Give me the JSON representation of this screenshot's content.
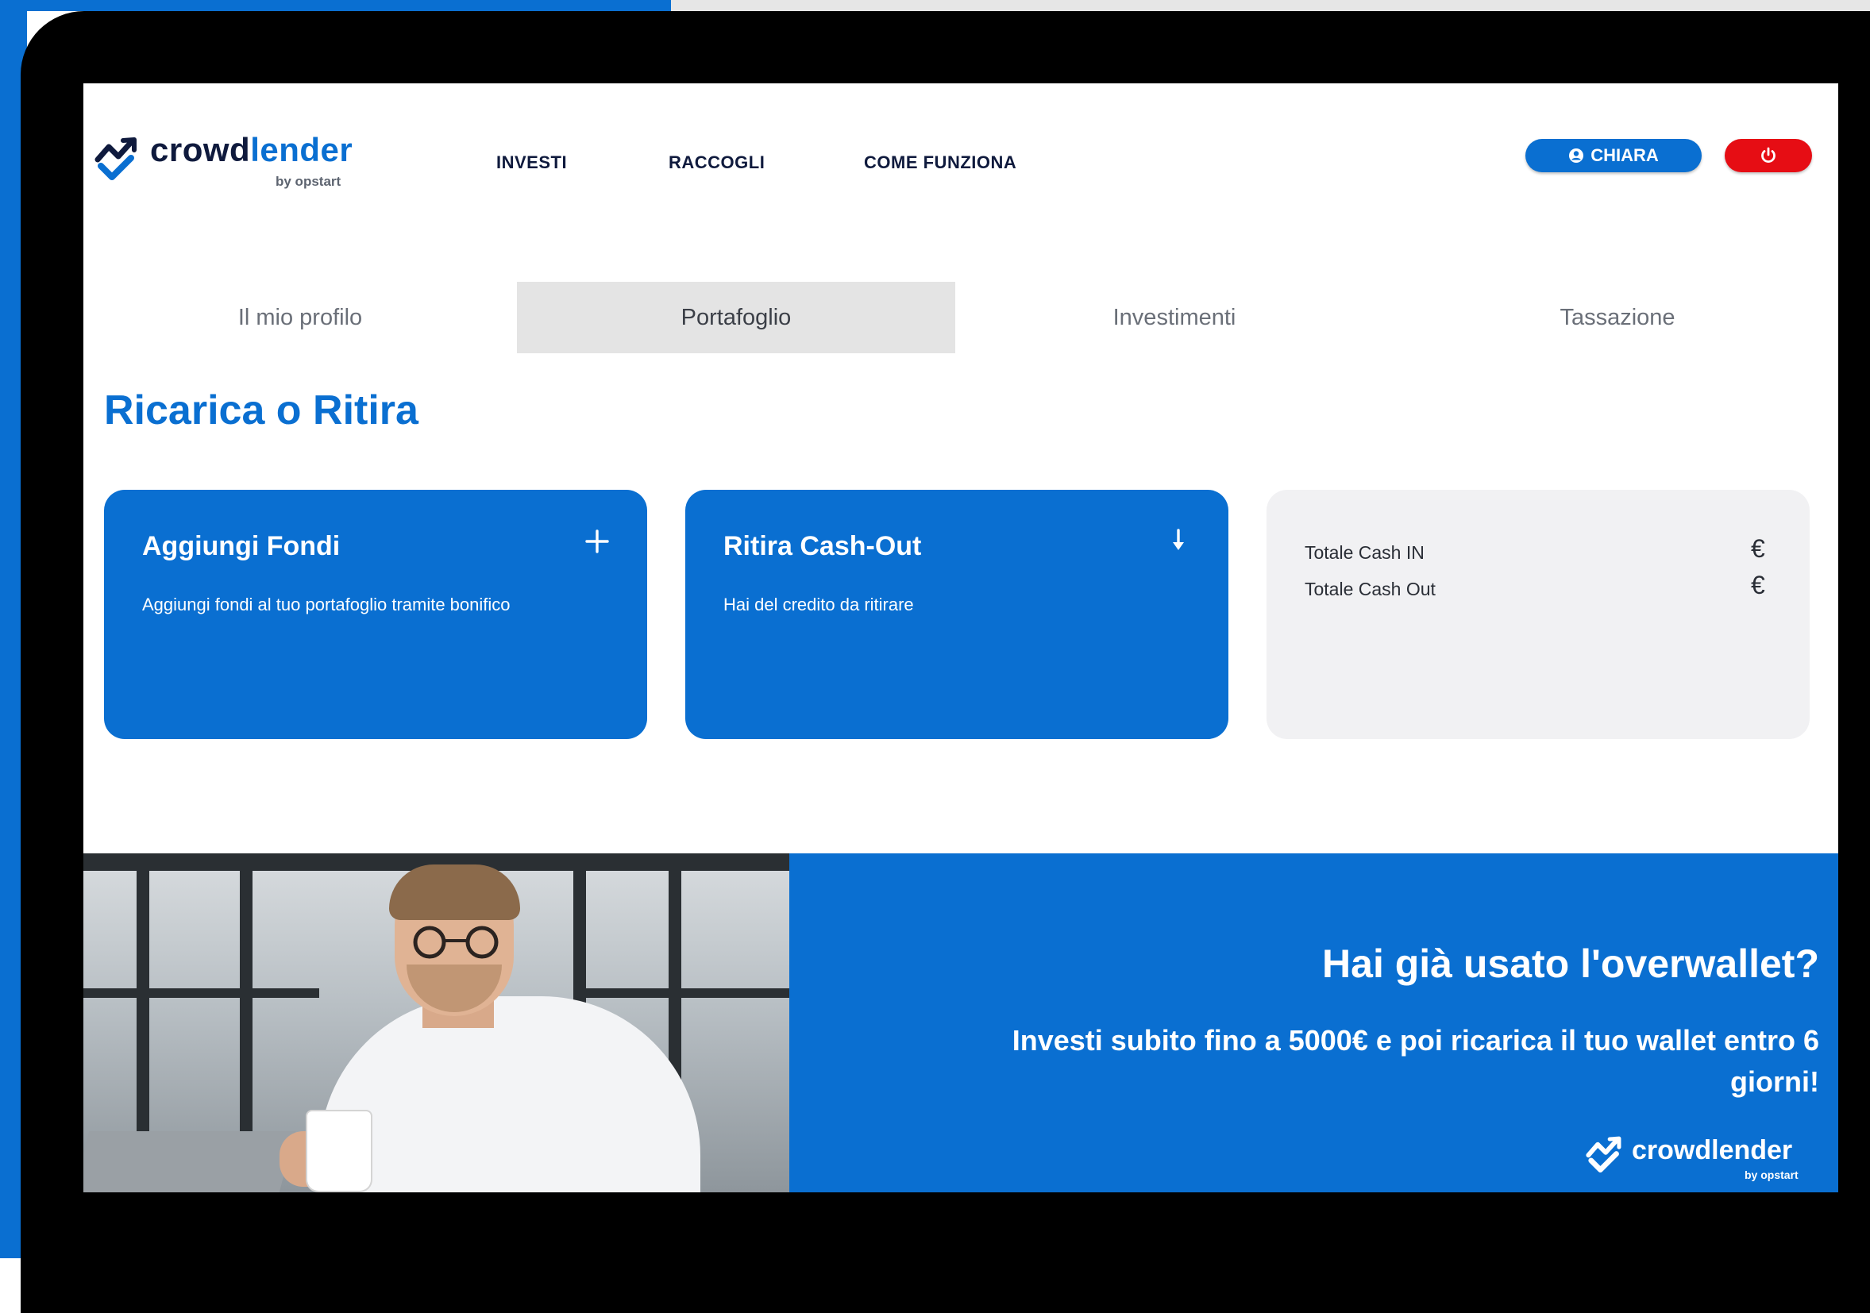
{
  "brand": {
    "name_dark": "crowd",
    "name_accent": "lender",
    "byline": "by opstart"
  },
  "nav": {
    "investi": "INVESTI",
    "raccogli": "RACCOGLI",
    "come_funziona": "COME FUNZIONA"
  },
  "user": {
    "name": "CHIARA"
  },
  "tabs": [
    {
      "label": "Il mio profilo",
      "active": false
    },
    {
      "label": "Portafoglio",
      "active": true
    },
    {
      "label": "Investimenti",
      "active": false
    },
    {
      "label": "Tassazione",
      "active": false
    }
  ],
  "section": {
    "title": "Ricarica o Ritira"
  },
  "cards": {
    "add": {
      "title": "Aggiungi Fondi",
      "desc": "Aggiungi fondi al tuo portafoglio tramite bonifico",
      "icon": "plus-icon"
    },
    "withdraw": {
      "title": "Ritira Cash-Out",
      "desc": "Hai del credito da ritirare",
      "icon": "arrow-down-icon"
    },
    "totals": {
      "cash_in_label": "Totale Cash IN",
      "cash_in_value": "€",
      "cash_out_label": "Totale Cash Out",
      "cash_out_value": "€"
    }
  },
  "banner": {
    "heading": "Hai già usato l'overwallet?",
    "text": "Investi subito fino a 5000€ e poi ricarica il tuo wallet entro 6 giorni!",
    "logo_text": "crowdlender",
    "logo_byline": "by opstart"
  },
  "colors": {
    "primary": "#0a6fd1",
    "danger": "#e60d14",
    "dark": "#0f1a3d",
    "tab_active_bg": "#e4e4e4",
    "card_gray": "#f1f1f3"
  }
}
